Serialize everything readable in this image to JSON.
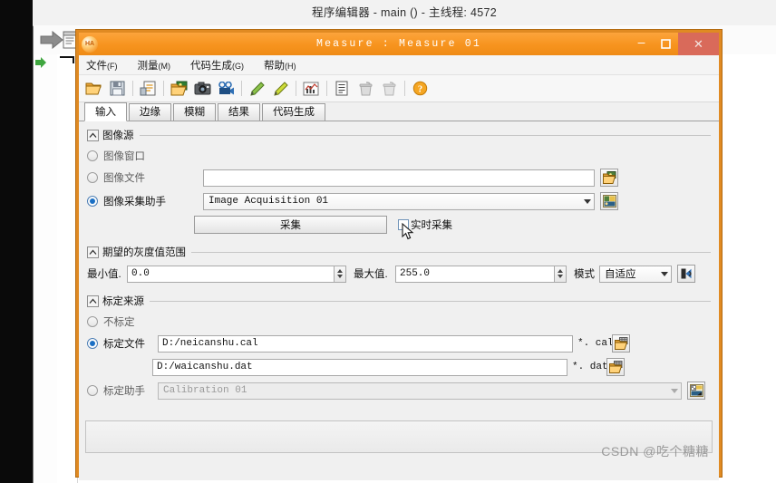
{
  "background": {
    "title": "程序编辑器 - main () - 主线程: 4572",
    "icons": [
      "right-arrow-icon",
      "document-icon",
      "green-arrow-icon"
    ]
  },
  "dialog": {
    "title": "Measure : Measure 01",
    "logo_text": "HA",
    "window_buttons": {
      "minimize": "–",
      "maximize": "❐",
      "close": "✕"
    },
    "menu": [
      {
        "label": "文件",
        "mnemonic": "(F)"
      },
      {
        "label": "测量",
        "mnemonic": "(M)"
      },
      {
        "label": "代码生成",
        "mnemonic": "(G)"
      },
      {
        "label": "帮助",
        "mnemonic": "(H)"
      }
    ],
    "toolbar_icons": [
      "open-folder-icon",
      "save-disk-icon",
      "save-as-icon",
      "open-image-icon",
      "camera-icon",
      "video-camera-icon",
      "pencil-green-icon",
      "pencil-yellow-icon",
      "chart-icon",
      "list-icon",
      "delete-trash-icon",
      "clear-trash-icon",
      "help-icon"
    ],
    "tabs": [
      {
        "label": "输入",
        "active": true
      },
      {
        "label": "边缘",
        "active": false
      },
      {
        "label": "模糊",
        "active": false
      },
      {
        "label": "结果",
        "active": false
      },
      {
        "label": "代码生成",
        "active": false
      }
    ],
    "image_source": {
      "group_title": "图像源",
      "options": [
        {
          "label": "图像窗口",
          "selected": false
        },
        {
          "label": "图像文件",
          "selected": false
        },
        {
          "label": "图像采集助手",
          "selected": true
        }
      ],
      "file_path": "",
      "file_path_placeholder": "",
      "acquisition_value": "Image Acquisition 01",
      "acquire_button": "采集",
      "live_checkbox_label": "实时采集",
      "live_checkbox_checked": false,
      "browse_icon": "open-image-folder-icon",
      "assistant_icon": "image-assistant-icon"
    },
    "gray_range": {
      "group_title": "期望的灰度值范围",
      "min_label": "最小值.",
      "min_value": "0.0",
      "max_label": "最大值.",
      "max_value": "255.0",
      "mode_label": "模式",
      "mode_value": "自适应",
      "apply_icon": "apply-arrow-icon"
    },
    "calibration": {
      "group_title": "标定来源",
      "options": [
        {
          "label": "不标定",
          "selected": false
        },
        {
          "label": "标定文件",
          "selected": true
        },
        {
          "label": "标定助手",
          "selected": false
        }
      ],
      "cal_file": "D:/neicanshu.cal",
      "cal_file_suffix": "*. cal",
      "dat_file": "D:/waicanshu.dat",
      "dat_file_suffix": "*. dat",
      "assistant_value": "Calibration 01",
      "browse_cal_icon": "open-cal-folder-icon",
      "browse_dat_icon": "open-dat-folder-icon",
      "assistant_icon": "calibration-assistant-icon"
    }
  },
  "watermark": {
    "prefix": "CSDN @",
    "name": "吃个糖糖"
  }
}
